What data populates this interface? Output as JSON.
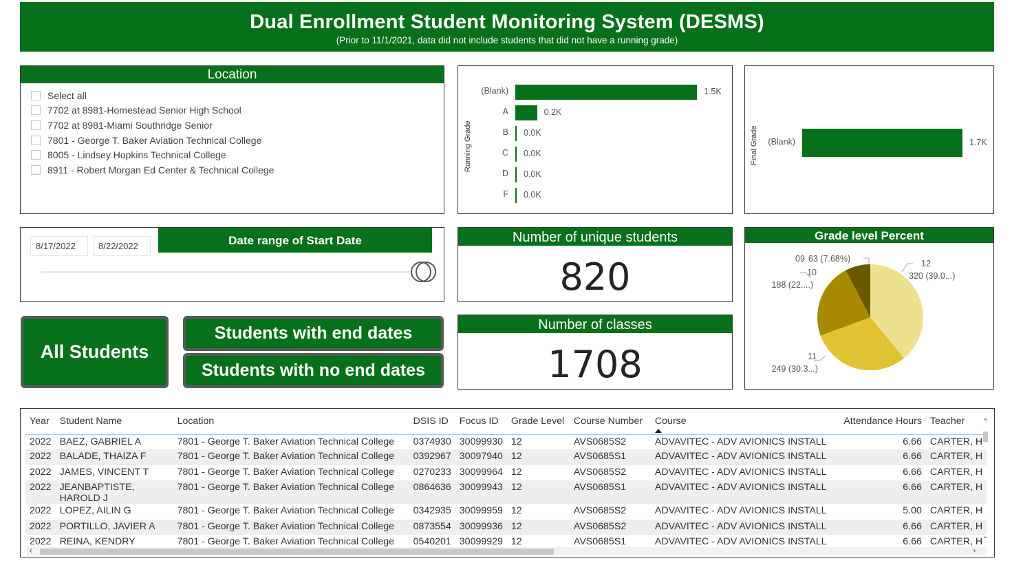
{
  "header": {
    "title": "Dual Enrollment Student Monitoring System (DESMS)",
    "subtitle": "(Prior to 11/1/2021, data did not include students that did not have a running grade)"
  },
  "location_slicer": {
    "title": "Location",
    "items": [
      {
        "label": "Select all",
        "checked": false
      },
      {
        "label": "7702 at 8981-Homestead Senior High School",
        "checked": false
      },
      {
        "label": "7702 at 8981-Miami Southridge Senior",
        "checked": false
      },
      {
        "label": "7801 - George T. Baker Aviation Technical College",
        "checked": false
      },
      {
        "label": "8005 - Lindsey Hopkins Technical College",
        "checked": false
      },
      {
        "label": "8911 - Robert Morgan Ed Center & Technical College",
        "checked": false
      }
    ]
  },
  "date_slicer": {
    "title": "Date range of Start Date",
    "start": "8/17/2022",
    "end": "8/22/2022"
  },
  "buttons": {
    "all_students": "All Students",
    "with_end_dates": "Students with end dates",
    "no_end_dates": "Students with no end dates"
  },
  "kpis": {
    "unique_students": {
      "title": "Number of unique students",
      "value": "820"
    },
    "classes": {
      "title": "Number of classes",
      "value": "1708"
    }
  },
  "colors": {
    "brand_green": "#07701a",
    "pie": [
      "#ede08f",
      "#e0c233",
      "#a88a00",
      "#6b5800"
    ]
  },
  "chart_data": [
    {
      "type": "bar",
      "orientation": "horizontal",
      "ylabel": "Running Grade",
      "categories": [
        "(Blank)",
        "A",
        "B",
        "C",
        "D",
        "F"
      ],
      "values": [
        1500,
        180,
        10,
        5,
        8,
        6
      ],
      "data_labels": [
        "1.5K",
        "0.2K",
        "0.0K",
        "0.0K",
        "0.0K",
        "0.0K"
      ],
      "xlim": [
        0,
        1500
      ]
    },
    {
      "type": "bar",
      "orientation": "horizontal",
      "ylabel": "Final Grade",
      "categories": [
        "(Blank)"
      ],
      "values": [
        1700
      ],
      "data_labels": [
        "1.7K"
      ],
      "xlim": [
        0,
        1700
      ]
    },
    {
      "type": "pie",
      "title": "Grade level Percent",
      "slices": [
        {
          "label": "12",
          "value": 320,
          "text": "320 (39.0...)"
        },
        {
          "label": "11",
          "value": 249,
          "text": "249 (30.3...)"
        },
        {
          "label": "10",
          "value": 188,
          "text": "188 (22....)"
        },
        {
          "label": "09",
          "value": 63,
          "text": "63 (7.68%)"
        }
      ]
    }
  ],
  "table": {
    "columns": [
      "Year",
      "Student Name",
      "Location",
      "DSIS ID",
      "Focus ID",
      "Grade Level",
      "Course Number",
      "Course",
      "Attendance Hours",
      "Teacher"
    ],
    "sorted_column": "Course",
    "rows": [
      [
        "2022",
        "BAEZ, GABRIEL A",
        "7801 - George T. Baker Aviation Technical College",
        "0374930",
        "30099930",
        "12",
        "AVS0685S2",
        "ADVAVITEC - ADV AVIONICS INSTALL",
        "6.66",
        "CARTER, H"
      ],
      [
        "2022",
        "BALADE, THAIZA F",
        "7801 - George T. Baker Aviation Technical College",
        "0392967",
        "30097940",
        "12",
        "AVS0685S1",
        "ADVAVITEC - ADV AVIONICS INSTALL",
        "6.66",
        "CARTER, H"
      ],
      [
        "2022",
        "JAMES, VINCENT T",
        "7801 - George T. Baker Aviation Technical College",
        "0270233",
        "30099964",
        "12",
        "AVS0685S2",
        "ADVAVITEC - ADV AVIONICS INSTALL",
        "6.66",
        "CARTER, H"
      ],
      [
        "2022",
        "JEANBAPTISTE, HAROLD J",
        "7801 - George T. Baker Aviation Technical College",
        "0864636",
        "30099943",
        "12",
        "AVS0685S1",
        "ADVAVITEC - ADV AVIONICS INSTALL",
        "6.66",
        "CARTER, H"
      ],
      [
        "2022",
        "LOPEZ, AILIN G",
        "7801 - George T. Baker Aviation Technical College",
        "0342935",
        "30099959",
        "12",
        "AVS0685S2",
        "ADVAVITEC - ADV AVIONICS INSTALL",
        "5.00",
        "CARTER, H"
      ],
      [
        "2022",
        "PORTILLO, JAVIER A",
        "7801 - George T. Baker Aviation Technical College",
        "0873554",
        "30099936",
        "12",
        "AVS0685S2",
        "ADVAVITEC - ADV AVIONICS INSTALL",
        "6.66",
        "CARTER, H"
      ],
      [
        "2022",
        "REINA, KENDRY",
        "7801 - George T. Baker Aviation Technical College",
        "0540201",
        "30099929",
        "12",
        "AVS0685S1",
        "ADVAVITEC - ADV AVIONICS INSTALL",
        "6.66",
        "CARTER, H"
      ]
    ]
  }
}
